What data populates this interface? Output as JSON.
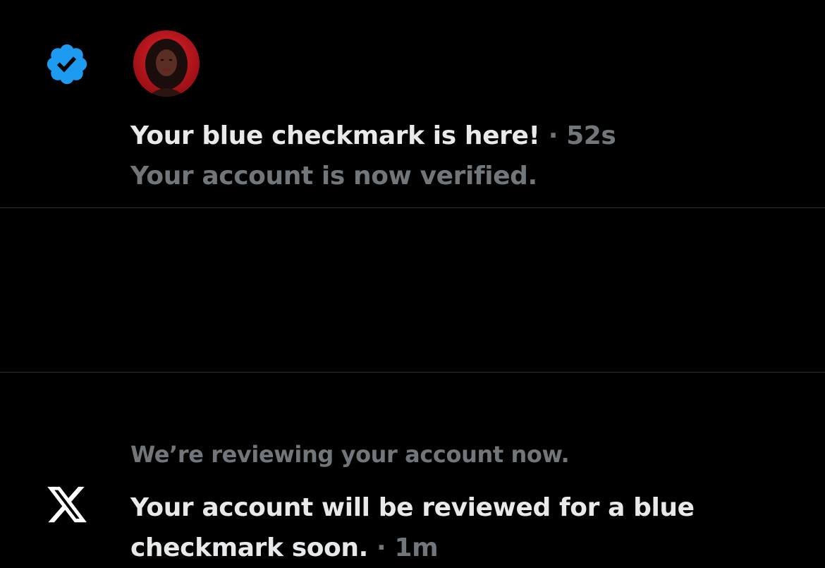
{
  "notifications": [
    {
      "title": "Your blue checkmark is here!",
      "separator": "·",
      "time": "52s",
      "subtitle": "Your account is now verified.",
      "icon": "verified-badge-icon",
      "badge_color": "#1d9bf0",
      "has_avatar": true
    },
    {
      "preview": "We’re reviewing your account now.",
      "body": "Your account will be reviewed for a blue checkmark soon.",
      "separator": "·",
      "time": "1m",
      "icon": "x-logo-icon"
    }
  ],
  "colors": {
    "background": "#000000",
    "primary_text": "#e7e9ea",
    "secondary_text": "#71767b",
    "divider": "#2f3336",
    "accent": "#1d9bf0"
  }
}
